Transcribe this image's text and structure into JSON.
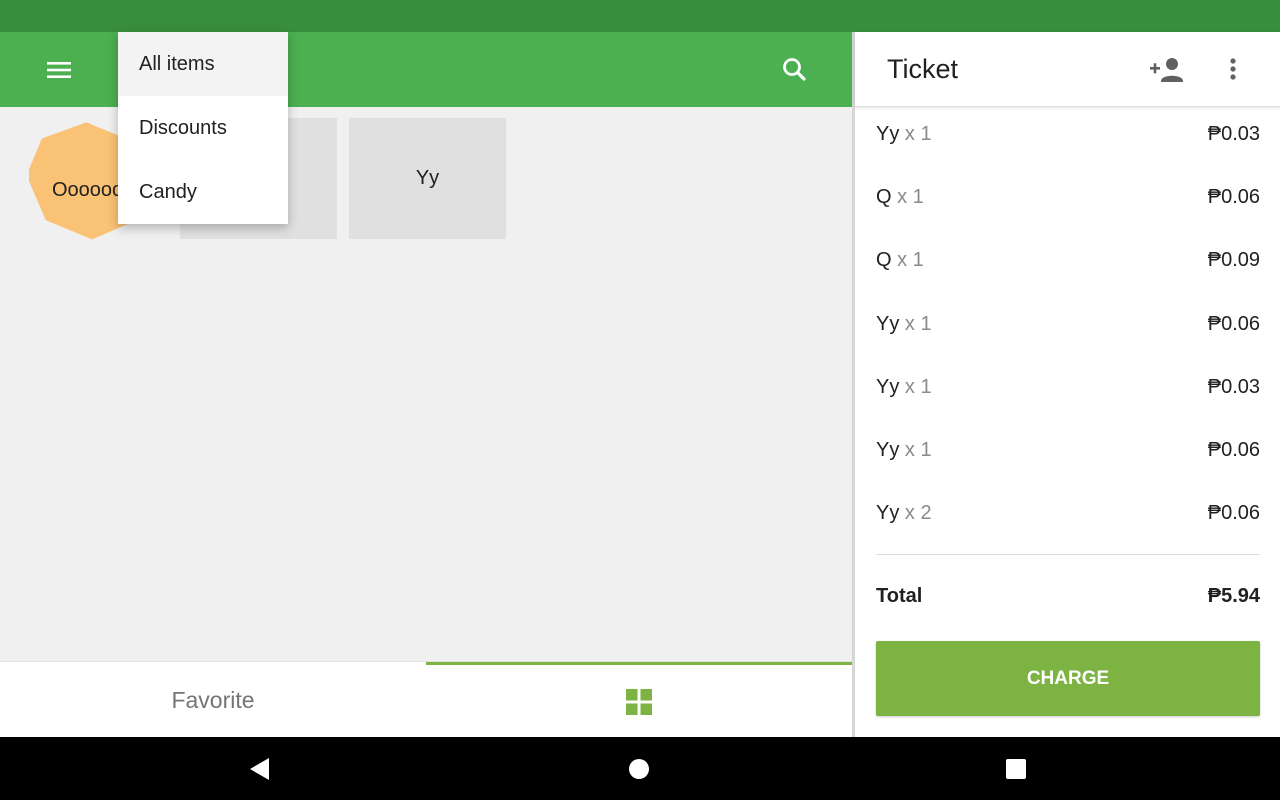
{
  "app_bar": {
    "menu_icon": "hamburger-menu-icon",
    "search_icon": "search-icon",
    "color": "#4caf50"
  },
  "category_dropdown": {
    "selected": "All items",
    "options": [
      "All items",
      "Discounts",
      "Candy"
    ]
  },
  "items": [
    {
      "label": "Oooooo",
      "shape": "octagon",
      "color": "#fac275"
    },
    {
      "label": "",
      "shape": "square",
      "color": "#e0e0e0"
    },
    {
      "label": "Yy",
      "shape": "square",
      "color": "#e0e0e0"
    }
  ],
  "tabs": {
    "favorite_label": "Favorite",
    "grid_icon": "grid-icon",
    "active": "grid"
  },
  "ticket": {
    "title": "Ticket",
    "add_customer_icon": "add-person-icon",
    "more_icon": "more-vert-icon",
    "lines": [
      {
        "name": "Yy",
        "qty": "x 1",
        "price": "₱0.03"
      },
      {
        "name": "Q",
        "qty": "x 1",
        "price": "₱0.06"
      },
      {
        "name": "Q",
        "qty": "x 1",
        "price": "₱0.09"
      },
      {
        "name": "Yy",
        "qty": "x 1",
        "price": "₱0.06"
      },
      {
        "name": "Yy",
        "qty": "x 1",
        "price": "₱0.03"
      },
      {
        "name": "Yy",
        "qty": "x 1",
        "price": "₱0.06"
      },
      {
        "name": "Yy",
        "qty": "x 2",
        "price": "₱0.06"
      }
    ],
    "total_label": "Total",
    "total_value": "₱5.94",
    "charge_label": "CHARGE",
    "accent": "#7cb342"
  },
  "nav": {
    "back_icon": "back-triangle-icon",
    "home_icon": "home-circle-icon",
    "recents_icon": "recents-square-icon"
  }
}
